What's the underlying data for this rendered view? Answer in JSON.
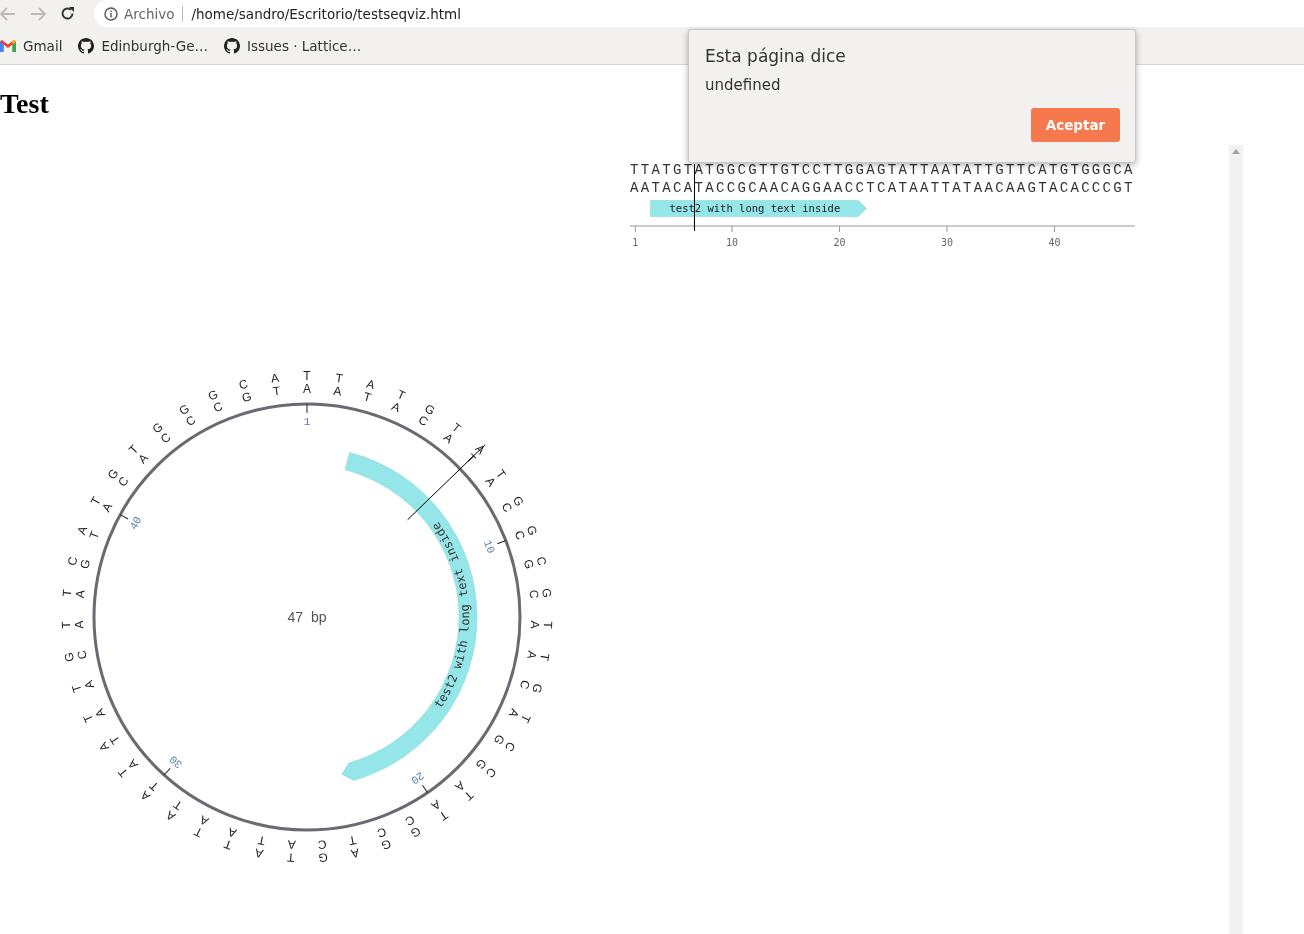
{
  "browser": {
    "address_prefix": "Archivo",
    "url": "/home/sandro/Escritorio/testseqviz.html",
    "bookmarks": [
      {
        "label": "Gmail"
      },
      {
        "label": "Edinburgh-Ge…"
      },
      {
        "label": "Issues · Lattice…"
      }
    ]
  },
  "page": {
    "heading": "Test"
  },
  "circular": {
    "top_strand": [
      "T",
      "T",
      "A",
      "T",
      "G",
      "T",
      "A",
      "T",
      "G",
      "G",
      "C",
      "G",
      "T",
      "T",
      "G",
      "T",
      "C",
      "C",
      "T",
      "T",
      "G",
      "G",
      "A",
      "G",
      "T",
      "A",
      "T",
      "T",
      "A",
      "A",
      "T",
      "A",
      "T",
      "T",
      "G",
      "T",
      "T",
      "C",
      "A",
      "T",
      "G",
      "T",
      "G",
      "G",
      "G",
      "C",
      "A"
    ],
    "bottom_strand": [
      "A",
      "A",
      "T",
      "A",
      "C",
      "A",
      "T",
      "A",
      "C",
      "C",
      "G",
      "C",
      "A",
      "A",
      "C",
      "A",
      "G",
      "G",
      "A",
      "A",
      "C",
      "C",
      "T",
      "C",
      "A",
      "T",
      "A",
      "A",
      "T",
      "T",
      "A",
      "T",
      "A",
      "A",
      "C",
      "A",
      "A",
      "G",
      "T",
      "A",
      "C",
      "A",
      "C",
      "C",
      "C",
      "G",
      "T"
    ],
    "length_label": "47 bp",
    "tick_labels": [
      "1",
      "10",
      "20",
      "30",
      "40"
    ],
    "feature_label": "test2 with long text inside"
  },
  "linear": {
    "top_strand": "TTATGTATGGCGTTGTCCTTGGAGTATTAATATTGTTCATGTGGGCA",
    "bottom_strand": "AATACATACCGCAACAGGAACCTCATAATTATAACAAGTACACCCGT",
    "feature_label": "test2 with long text inside",
    "tick_labels": [
      "1",
      "10",
      "20",
      "30",
      "40"
    ]
  },
  "dialog": {
    "title": "Esta página dice",
    "message": "undefined",
    "button": "Aceptar"
  }
}
